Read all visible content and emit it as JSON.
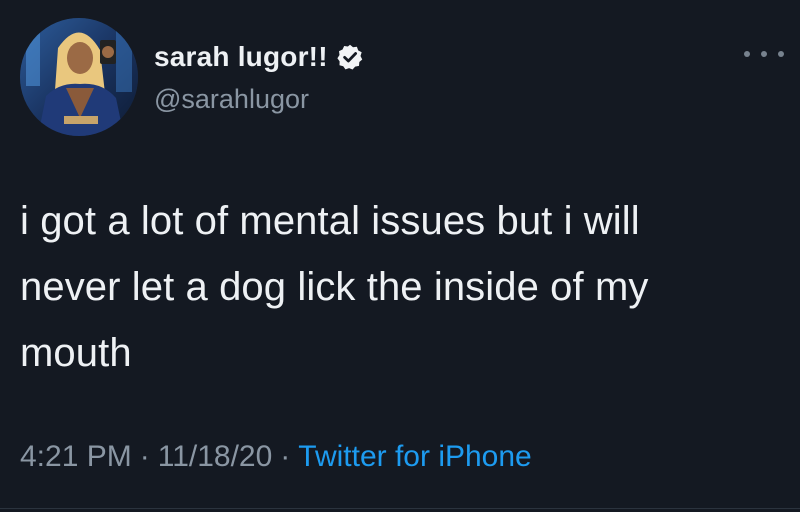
{
  "tweet": {
    "display_name": "sarah lugor!!",
    "handle": "@sarahlugor",
    "verified": true,
    "text_lines": [
      "i got a lot of mental issues but i will",
      "never let a dog lick the inside of my",
      "mouth"
    ],
    "time": "4:21 PM",
    "date": "11/18/20",
    "separator": "·",
    "source": "Twitter for iPhone"
  },
  "icons": {
    "verified": "verified-badge-icon",
    "more": "more-horizontal-icon"
  },
  "colors": {
    "background": "#141922",
    "text": "#eef1f4",
    "secondary_text": "#8a96a3",
    "link": "#1d9bf0"
  }
}
